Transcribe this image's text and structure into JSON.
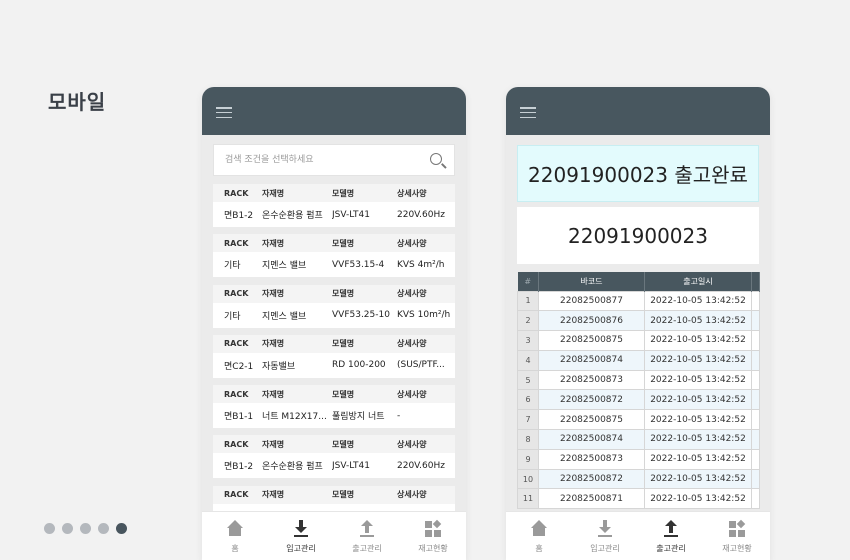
{
  "page": {
    "section_title": "모바일"
  },
  "left_phone": {
    "search_placeholder": "검색 조건을 선택하세요",
    "columns": [
      "RACK",
      "자재명",
      "모델명",
      "상세사양"
    ],
    "items": [
      {
        "rack": "면B1-2",
        "name": "온수순환용 펌프",
        "model": "JSV-LT41",
        "spec": "220V.60Hz"
      },
      {
        "rack": "기타",
        "name": "지멘스 밸브",
        "model": "VVF53.15-4",
        "spec": "KVS 4m²/h"
      },
      {
        "rack": "기타",
        "name": "지멘스 밸브",
        "model": "VVF53.25-10",
        "spec": "KVS 10m²/h"
      },
      {
        "rack": "면C2-1",
        "name": "자동밸브",
        "model": "RD 100-200",
        "spec": "(SUS/PTF..."
      },
      {
        "rack": "면B1-1",
        "name": "너트 M12X17...",
        "model": "풀림방지 너트",
        "spec": "-"
      },
      {
        "rack": "면B1-2",
        "name": "온수순환용 펌프",
        "model": "JSV-LT41",
        "spec": "220V.60Hz"
      },
      {
        "rack": "",
        "name": "",
        "model": "",
        "spec": ""
      }
    ],
    "nav": [
      {
        "label": "홈",
        "icon": "home-icon",
        "active": false
      },
      {
        "label": "입고관리",
        "icon": "download-icon",
        "active": true
      },
      {
        "label": "출고관리",
        "icon": "upload-icon",
        "active": false
      },
      {
        "label": "재고현황",
        "icon": "inventory-icon",
        "active": false
      }
    ]
  },
  "right_phone": {
    "status_text": "22091900023 출고완료",
    "code_text": "22091900023",
    "table_headers": [
      "#",
      "바코드",
      "출고일시"
    ],
    "rows": [
      {
        "idx": "1",
        "barcode": "22082500877",
        "time": "2022-10-05 13:42:52"
      },
      {
        "idx": "2",
        "barcode": "22082500876",
        "time": "2022-10-05 13:42:52"
      },
      {
        "idx": "3",
        "barcode": "22082500875",
        "time": "2022-10-05 13:42:52"
      },
      {
        "idx": "4",
        "barcode": "22082500874",
        "time": "2022-10-05 13:42:52"
      },
      {
        "idx": "5",
        "barcode": "22082500873",
        "time": "2022-10-05 13:42:52"
      },
      {
        "idx": "6",
        "barcode": "22082500872",
        "time": "2022-10-05 13:42:52"
      },
      {
        "idx": "7",
        "barcode": "22082500875",
        "time": "2022-10-05 13:42:52"
      },
      {
        "idx": "8",
        "barcode": "22082500874",
        "time": "2022-10-05 13:42:52"
      },
      {
        "idx": "9",
        "barcode": "22082500873",
        "time": "2022-10-05 13:42:52"
      },
      {
        "idx": "10",
        "barcode": "22082500872",
        "time": "2022-10-05 13:42:52"
      },
      {
        "idx": "11",
        "barcode": "22082500871",
        "time": "2022-10-05 13:42:52"
      }
    ],
    "nav": [
      {
        "label": "홈",
        "icon": "home-icon",
        "active": false
      },
      {
        "label": "입고관리",
        "icon": "download-icon",
        "active": false
      },
      {
        "label": "출고관리",
        "icon": "upload-icon",
        "active": true
      },
      {
        "label": "재고현황",
        "icon": "inventory-icon",
        "active": false
      }
    ]
  },
  "pagination": {
    "count": 5,
    "active_index": 4,
    "active_color": "#48555e",
    "inactive_color": "#b4b8bd"
  },
  "colors": {
    "header": "#48575f",
    "status_bg": "#e3fbfd",
    "background": "#f2f2f2"
  }
}
